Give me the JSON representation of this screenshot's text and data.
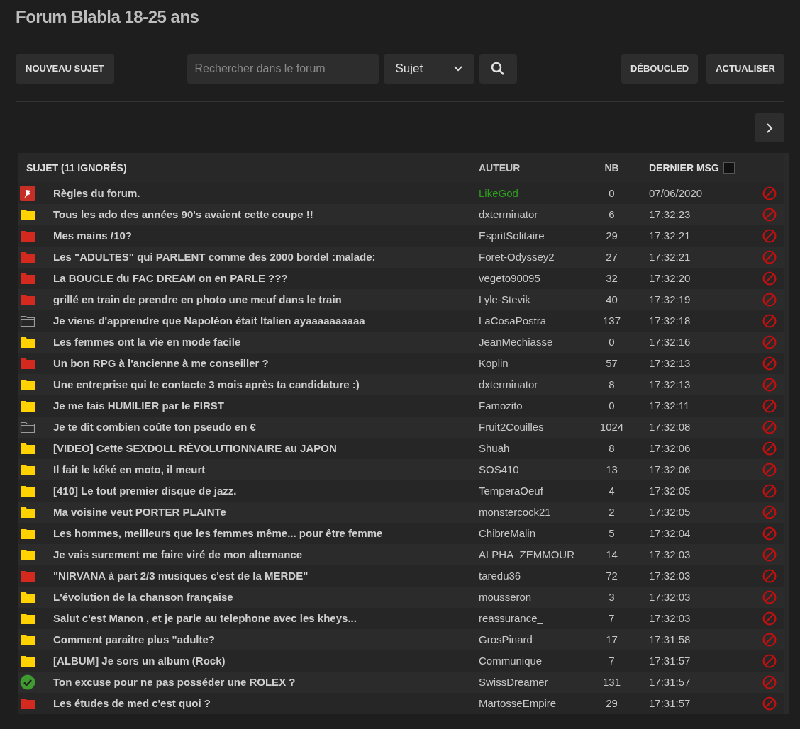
{
  "title": "Forum Blabla 18-25 ans",
  "toolbar": {
    "new_topic": "NOUVEAU SUJET",
    "search": {
      "placeholder": "Rechercher dans le forum"
    },
    "search_scope": "Sujet",
    "buttons": [
      "DÉBOUCLED",
      "ACTUALISER"
    ]
  },
  "table": {
    "columns": [
      "SUJET (11 IGNORÉS)",
      "AUTEUR",
      "NB",
      "DERNIER MSG"
    ],
    "last_msg_checked": false,
    "rows": [
      {
        "kind": "pinned",
        "subject": "Règles du forum.",
        "author": "LikeGod",
        "color": "#2f9e1f",
        "nb": "0",
        "last": "07/06/2020"
      },
      {
        "kind": "normal",
        "subject": "Tous les ado des années 90's avaient cette coupe !!",
        "author": "dxterminator",
        "color": "#c8c8c8",
        "nb": "6",
        "last": "17:32:23"
      },
      {
        "kind": "hot",
        "subject": "Mes mains /10?",
        "author": "EspritSolitaire",
        "color": "#c8c8c8",
        "nb": "29",
        "last": "17:32:21"
      },
      {
        "kind": "hot",
        "subject": "Les \"ADULTES\" qui PARLENT comme des 2000 bordel :malade:",
        "author": "Foret-Odyssey2",
        "color": "#c8c8c8",
        "nb": "27",
        "last": "17:32:21"
      },
      {
        "kind": "hot",
        "subject": "La BOUCLE du FAC DREAM on en PARLE ???",
        "author": "vegeto90095",
        "color": "#c8c8c8",
        "nb": "32",
        "last": "17:32:20"
      },
      {
        "kind": "hot",
        "subject": "grillé en train de prendre en photo une meuf dans le train",
        "author": "Lyle-Stevik",
        "color": "#c8c8c8",
        "nb": "40",
        "last": "17:32:19"
      },
      {
        "kind": "locked",
        "subject": "Je viens d'apprendre que Napoléon était Italien ayaaaaaaaaaa",
        "author": "LaCosaPostra",
        "color": "#c8c8c8",
        "nb": "137",
        "last": "17:32:18"
      },
      {
        "kind": "normal",
        "subject": "Les femmes ont la vie en mode facile",
        "author": "JeanMechiasse",
        "color": "#c8c8c8",
        "nb": "0",
        "last": "17:32:16"
      },
      {
        "kind": "hot",
        "subject": "Un bon RPG à l'ancienne à me conseiller ?",
        "author": "Koplin",
        "color": "#c8c8c8",
        "nb": "57",
        "last": "17:32:13"
      },
      {
        "kind": "normal",
        "subject": "Une entreprise qui te contacte 3 mois après ta candidature :)",
        "author": "dxterminator",
        "color": "#c8c8c8",
        "nb": "8",
        "last": "17:32:13"
      },
      {
        "kind": "normal",
        "subject": "Je me fais HUMILIER par le FIRST",
        "author": "Famozito",
        "color": "#c8c8c8",
        "nb": "0",
        "last": "17:32:11"
      },
      {
        "kind": "locked",
        "subject": "Je te dit combien coûte ton pseudo en €",
        "author": "Fruit2Couilles",
        "color": "#c8c8c8",
        "nb": "1024",
        "last": "17:32:08"
      },
      {
        "kind": "normal",
        "subject": "[VIDEO] Cette SEXDOLL RÉVOLUTIONNAIRE au JAPON",
        "author": "Shuah",
        "color": "#c8c8c8",
        "nb": "8",
        "last": "17:32:06"
      },
      {
        "kind": "normal",
        "subject": "Il fait le kéké en moto, il meurt",
        "author": "SOS410",
        "color": "#c8c8c8",
        "nb": "13",
        "last": "17:32:06"
      },
      {
        "kind": "normal",
        "subject": "[410] Le tout premier disque de jazz.",
        "author": "TemperaOeuf",
        "color": "#c8c8c8",
        "nb": "4",
        "last": "17:32:05"
      },
      {
        "kind": "normal",
        "subject": "Ma voisine veut PORTER PLAINTe",
        "author": "monstercock21",
        "color": "#c8c8c8",
        "nb": "2",
        "last": "17:32:05"
      },
      {
        "kind": "normal",
        "subject": "Les hommes, meilleurs que les femmes même... pour être femme",
        "author": "ChibreMalin",
        "color": "#c8c8c8",
        "nb": "5",
        "last": "17:32:04"
      },
      {
        "kind": "normal",
        "subject": "Je vais surement me faire viré de mon alternance",
        "author": "ALPHA_ZEMMOUR",
        "color": "#c8c8c8",
        "nb": "14",
        "last": "17:32:03"
      },
      {
        "kind": "hot",
        "subject": "\"NIRVANA à part 2/3 musiques c'est de la MERDE\"",
        "author": "taredu36",
        "color": "#c8c8c8",
        "nb": "72",
        "last": "17:32:03"
      },
      {
        "kind": "normal",
        "subject": "L'évolution de la chanson française",
        "author": "mousseron",
        "color": "#c8c8c8",
        "nb": "3",
        "last": "17:32:03"
      },
      {
        "kind": "normal",
        "subject": "Salut c'est Manon , et je parle au telephone avec les kheys...",
        "author": "reassurance_",
        "color": "#c8c8c8",
        "nb": "7",
        "last": "17:32:03"
      },
      {
        "kind": "normal",
        "subject": "Comment paraître plus \"adulte?",
        "author": "GrosPinard",
        "color": "#c8c8c8",
        "nb": "17",
        "last": "17:31:58"
      },
      {
        "kind": "normal",
        "subject": "[ALBUM] Je sors un album (Rock)",
        "author": "Communique",
        "color": "#c8c8c8",
        "nb": "7",
        "last": "17:31:57"
      },
      {
        "kind": "resolved",
        "subject": "Ton excuse pour ne pas posséder une ROLEX ?",
        "author": "SwissDreamer",
        "color": "#c8c8c8",
        "nb": "131",
        "last": "17:31:57"
      },
      {
        "kind": "hot",
        "subject": "Les études de med c'est quoi ?",
        "author": "MartosseEmpire",
        "color": "#c8c8c8",
        "nb": "29",
        "last": "17:31:57"
      }
    ]
  }
}
